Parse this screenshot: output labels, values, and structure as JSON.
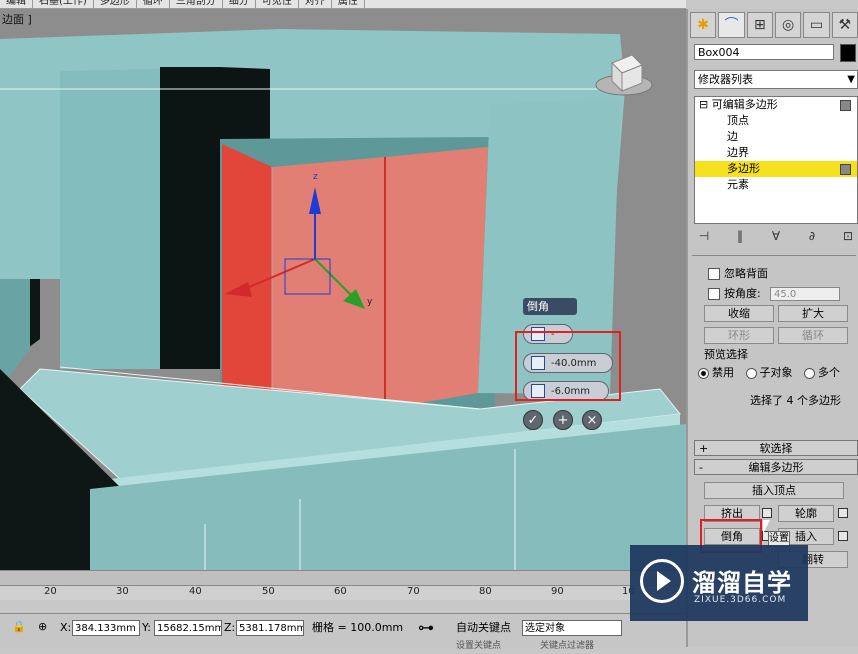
{
  "menu": {
    "items": [
      "编辑",
      "石墨(工作)",
      "多边形",
      "循环",
      "三角剖分",
      "细分",
      "可见性",
      "对齐",
      "属性"
    ]
  },
  "viewport": {
    "label": "边面 ]",
    "caddy": {
      "title": "倒角",
      "type_value": "-",
      "height_value": "-40.0mm",
      "outline_value": "-6.0mm",
      "ok_glyph": "✓",
      "apply_glyph": "+",
      "cancel_glyph": "×"
    }
  },
  "command_panel": {
    "tabs": [
      "✱",
      "⌒",
      "⊞",
      "◎",
      "▭",
      "⚒"
    ],
    "object_name": "Box004",
    "modifier_list": "修改器列表",
    "stack": {
      "root": "可编辑多边形",
      "items": [
        "顶点",
        "边",
        "边界",
        "多边形",
        "元素"
      ],
      "selected": "多边形"
    },
    "toolbar_glyphs": [
      "⊣",
      "‖",
      "∀",
      "∂",
      "⊡"
    ],
    "selection": {
      "ignore_backface": "忽略背面",
      "by_angle_label": "按角度:",
      "by_angle_value": "45.0",
      "shrink": "收缩",
      "grow": "扩大",
      "ring": "环形",
      "loop": "循环",
      "preview_label": "预览选择",
      "preview_options": [
        "禁用",
        "子对象",
        "多个"
      ],
      "status": "选择了 4 个多边形"
    },
    "soft_selection": "软选择",
    "edit_polygons": "编辑多边形",
    "insert_vertex": "插入顶点",
    "extrude": "挤出",
    "outline": "轮廓",
    "bevel": "倒角",
    "inset": "插入",
    "flip": "翻转",
    "inset_settings_overlay": "设置"
  },
  "timeline": {
    "ticks": [
      "20",
      "30",
      "40",
      "50",
      "60",
      "70",
      "80",
      "90",
      "10"
    ]
  },
  "statusbar": {
    "x_label": "X:",
    "x_value": "384.133mm",
    "y_label": "Y:",
    "y_value": "15682.15mm",
    "z_label": "Z:",
    "z_value": "5381.178mm",
    "grid": "栅格 = 100.0mm",
    "auto_key": "自动关键点",
    "selected_object": "选定对象",
    "set_key": "设置关键点",
    "key_filter": "关键点过滤器"
  },
  "watermark": {
    "title": "溜溜自学",
    "url": "ZIXUE.3D66.COM"
  }
}
